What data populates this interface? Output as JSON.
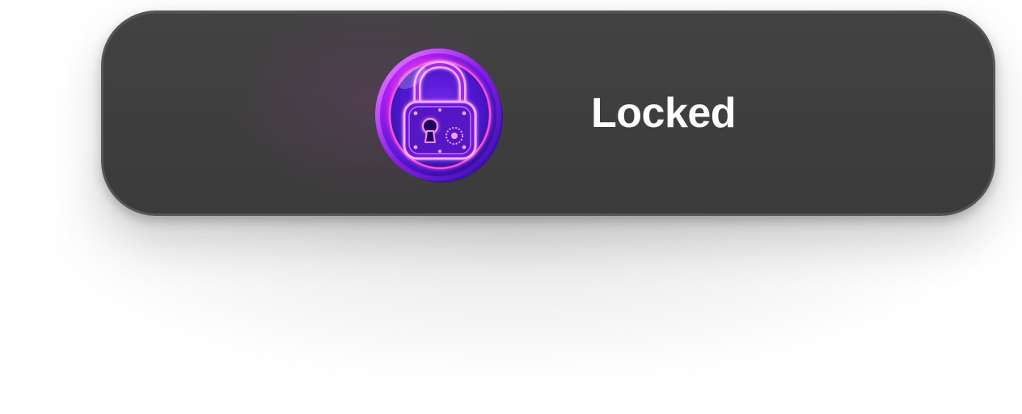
{
  "hud": {
    "status_label": "Locked",
    "icon": "lock-icon"
  },
  "colors": {
    "panel_background": "#3e3e3e",
    "panel_border": "#555555",
    "label_text": "#ffffff",
    "icon_primary": "#c21cff",
    "icon_secondary": "#3a12c8",
    "icon_glow": "#ff3fd0"
  }
}
